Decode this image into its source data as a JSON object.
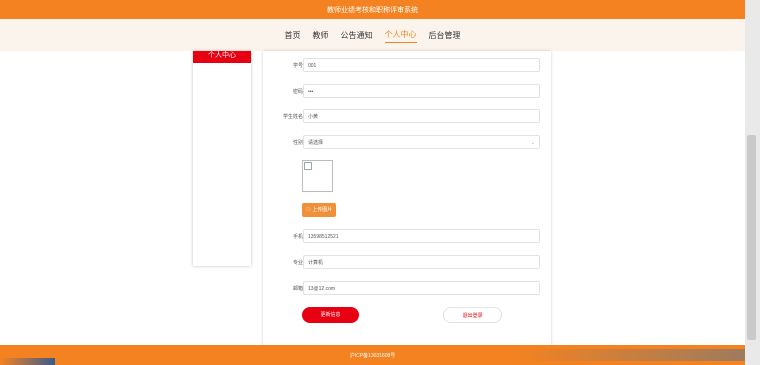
{
  "header": {
    "title": "教师业绩考核和职称评审系统"
  },
  "nav": {
    "items": [
      {
        "label": "首页"
      },
      {
        "label": "教师"
      },
      {
        "label": "公告通知"
      },
      {
        "label": "个人中心"
      },
      {
        "label": "后台管理"
      }
    ],
    "active": "个人中心"
  },
  "sidebar": {
    "active_item": "个人中心"
  },
  "form": {
    "fields": [
      {
        "label": "学号",
        "value": "001"
      },
      {
        "label": "密码",
        "value": "•••"
      },
      {
        "label": "学生姓名",
        "value": "小黄"
      },
      {
        "label": "性别",
        "value": "请选择"
      },
      {
        "label": "手机",
        "value": "13598512521"
      },
      {
        "label": "专业",
        "value": "计算机"
      },
      {
        "label": "邮箱",
        "value": "13@12.com"
      }
    ],
    "upload_label": "上传图片",
    "update_button": "更新信息",
    "logout_button": "退出登录"
  },
  "footer": {
    "text": "沪ICP备13031608号"
  },
  "colors": {
    "brand": "#f58220",
    "accent": "#e60012"
  }
}
